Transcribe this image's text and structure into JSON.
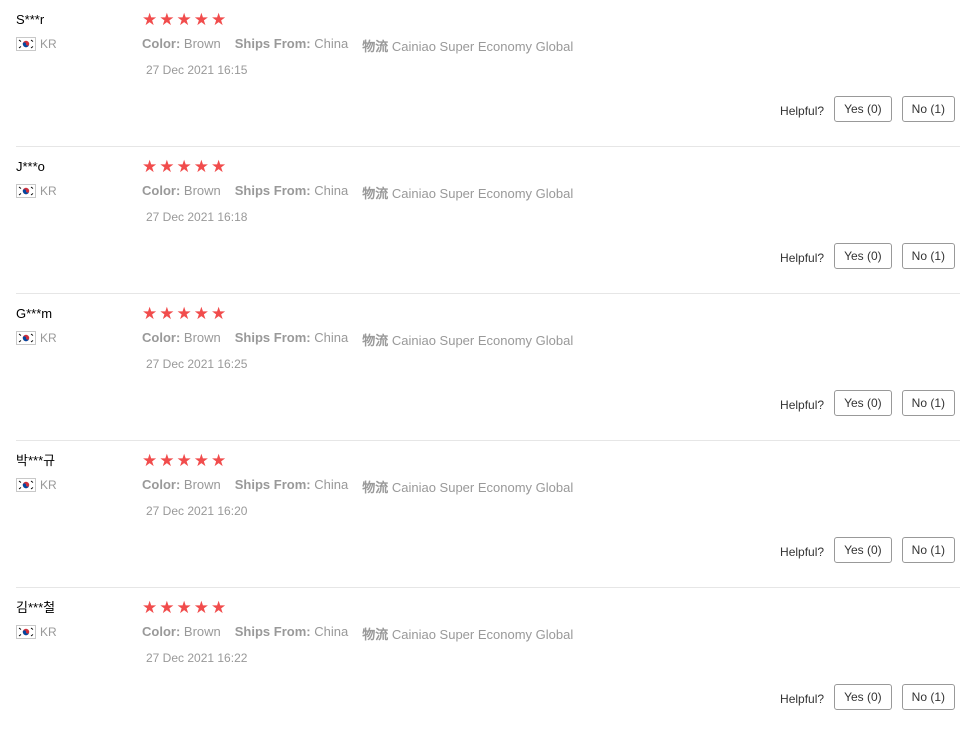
{
  "reviews": [
    {
      "user": "S***r",
      "country": "KR",
      "stars": 5,
      "color_label": "Color:",
      "color": "Brown",
      "ships_label": "Ships From:",
      "ships": "China",
      "logistics_label": "物流",
      "logistics": "Cainiao Super Economy Global",
      "date": "27 Dec 2021 16:15",
      "helpful": "Helpful?",
      "yes": "Yes (0)",
      "no": "No (1)"
    },
    {
      "user": "J***o",
      "country": "KR",
      "stars": 5,
      "color_label": "Color:",
      "color": "Brown",
      "ships_label": "Ships From:",
      "ships": "China",
      "logistics_label": "物流",
      "logistics": "Cainiao Super Economy Global",
      "date": "27 Dec 2021 16:18",
      "helpful": "Helpful?",
      "yes": "Yes (0)",
      "no": "No (1)"
    },
    {
      "user": "G***m",
      "country": "KR",
      "stars": 5,
      "color_label": "Color:",
      "color": "Brown",
      "ships_label": "Ships From:",
      "ships": "China",
      "logistics_label": "物流",
      "logistics": "Cainiao Super Economy Global",
      "date": "27 Dec 2021 16:25",
      "helpful": "Helpful?",
      "yes": "Yes (0)",
      "no": "No (1)"
    },
    {
      "user": "박***규",
      "country": "KR",
      "stars": 5,
      "color_label": "Color:",
      "color": "Brown",
      "ships_label": "Ships From:",
      "ships": "China",
      "logistics_label": "物流",
      "logistics": "Cainiao Super Economy Global",
      "date": "27 Dec 2021 16:20",
      "helpful": "Helpful?",
      "yes": "Yes (0)",
      "no": "No (1)"
    },
    {
      "user": "김***철",
      "country": "KR",
      "stars": 5,
      "color_label": "Color:",
      "color": "Brown",
      "ships_label": "Ships From:",
      "ships": "China",
      "logistics_label": "物流",
      "logistics": "Cainiao Super Economy Global",
      "date": "27 Dec 2021 16:22",
      "helpful": "Helpful?",
      "yes": "Yes (0)",
      "no": "No (1)"
    }
  ],
  "star_icon": "star-icon",
  "flag_icon": "south-korea-flag-icon",
  "colors": {
    "star": "#f14c4c",
    "meta": "#999999",
    "border": "#e6e6e6"
  }
}
